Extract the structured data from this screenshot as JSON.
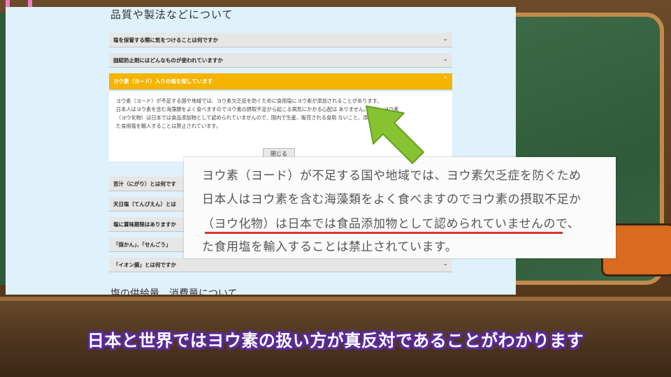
{
  "page": {
    "heading": "品質や製法などについて",
    "faqs": [
      {
        "question": "塩を保管する際に気をつけることは何ですか",
        "state": "collapsed"
      },
      {
        "question": "固結防止剤にはどんなものが使われていますか",
        "state": "collapsed"
      },
      {
        "question": "ヨウ素（ヨード）入りの塩を探しています",
        "state": "expanded"
      },
      {
        "question": "苦汁（にがり）とは何です",
        "state": "collapsed"
      },
      {
        "question": "天日塩（てんぴえん）とは",
        "state": "collapsed"
      },
      {
        "question": "塩に賞味期限はありますか",
        "state": "collapsed"
      },
      {
        "question": "「採かん」、「せんごう」",
        "state": "collapsed"
      },
      {
        "question": "「イオン膜」とは何ですか",
        "state": "collapsed"
      }
    ],
    "answer_lines": [
      "ヨウ素（ヨード）が不足する国や地域では、ヨウ素欠乏症を防ぐために食用塩にヨウ素が添加されることがあります。",
      "日本人はヨウ素を含む海藻類をよく食べますのでヨウ素の摂取不足から起こる病気にかかる心配は ありません。なお、ヨウ素",
      "（ヨウ化物）は日本では食品添加物として認められていませんので、国内で生産、販売される食用 ないこと、添加され",
      "た食用塩を輸入することは禁止されています。"
    ],
    "close_label": "閉じる",
    "section2_heading": "塩の供給量、消費量について",
    "accent_color": "#f5b400"
  },
  "zoom": {
    "lines": [
      "ヨウ素（ヨード）が不足する国や地域では、ヨウ素欠乏症を防ぐため",
      "日本人はヨウ素を含む海藻類をよく食べますのでヨウ素の摂取不足か",
      "（ヨウ化物）は日本では食品添加物として認められていませんので、",
      "た食用塩を輸入することは禁止されています。"
    ],
    "underline_color": "#e03030"
  },
  "arrow": {
    "icon": "arrow-up-left-icon",
    "color": "#86c232"
  },
  "subtitle": {
    "text": "日本と世界ではヨウ素の扱い方が真反対であることがわかります",
    "outline_color": "#5a2a9a"
  }
}
